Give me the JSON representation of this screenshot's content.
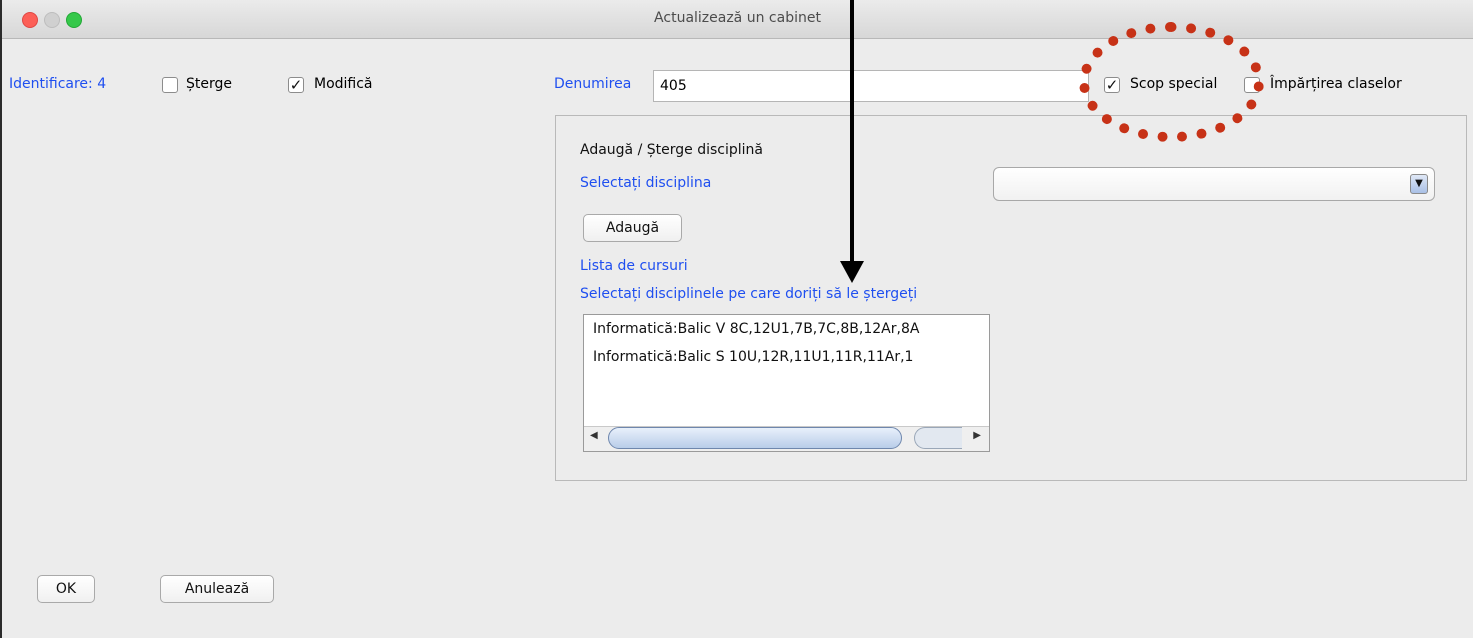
{
  "window": {
    "title": "Actualizează un cabinet"
  },
  "identification": {
    "label": "Identificare: 4"
  },
  "options": {
    "delete_label": "Șterge",
    "delete_checked": false,
    "modify_label": "Modifică",
    "modify_checked": true,
    "special_label": "Scop special",
    "special_checked": true,
    "split_label": "Împărțirea claselor",
    "split_checked": false
  },
  "name_field": {
    "label": "Denumirea",
    "value": "405"
  },
  "panel": {
    "heading": "Adaugă / Șterge disciplină",
    "select_label": "Selectați disciplina",
    "dropdown_value": "",
    "add_button": "Adaugă",
    "courses_label": "Lista de cursuri",
    "delete_hint": "Selectați disciplinele pe care doriți să le ștergeți",
    "courses": [
      "Informatică:Balic V 8C,12U1,7B,7C,8B,12Ar,8A",
      "Informatică:Balic S 10U,12R,11U1,11R,11Ar,1"
    ]
  },
  "footer": {
    "ok_button": "OK",
    "cancel_button": "Anulează"
  },
  "colors": {
    "label_blue": "#1f4ff0",
    "annotation_red": "#c73217"
  }
}
